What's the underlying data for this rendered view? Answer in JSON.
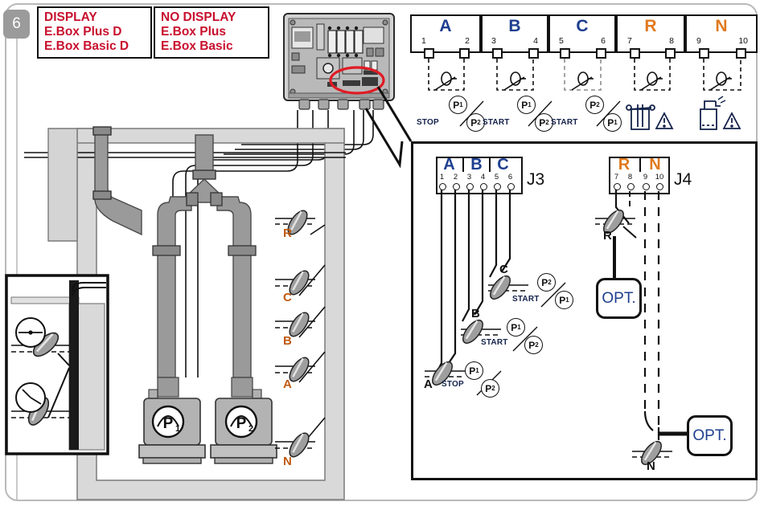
{
  "step": {
    "number": "6"
  },
  "legend": {
    "display": {
      "title": "DISPLAY",
      "line1": "E.Box Plus D",
      "line2": "E.Box Basic D"
    },
    "no_display": {
      "title": "NO DISPLAY",
      "line1": "E.Box Plus",
      "line2": "E.Box Basic"
    },
    "color": "#c8102e"
  },
  "terminal_strip": {
    "groups": [
      {
        "letter": "A",
        "pins": [
          "1",
          "2"
        ],
        "function": "STOP",
        "pumps": [
          "P1",
          "P2"
        ],
        "icon": "float-switch-icon"
      },
      {
        "letter": "B",
        "pins": [
          "3",
          "4"
        ],
        "function": "START",
        "pumps": [
          "P1",
          "P2"
        ],
        "icon": "float-switch-icon"
      },
      {
        "letter": "C",
        "pins": [
          "5",
          "6"
        ],
        "function": "START",
        "pumps": [
          "P2",
          "P1"
        ],
        "icon": "float-switch-icon"
      },
      {
        "letter": "R",
        "pins": [
          "7",
          "8"
        ],
        "function": "",
        "pumps": [],
        "icon": "high-level-alarm-icon"
      },
      {
        "letter": "N",
        "pins": [
          "9",
          "10"
        ],
        "function": "",
        "pumps": [],
        "icon": "dry-run-alarm-icon"
      }
    ]
  },
  "detail": {
    "j3": {
      "label": "J3",
      "groups": [
        {
          "letter": "A",
          "pins": [
            "1",
            "2"
          ]
        },
        {
          "letter": "B",
          "pins": [
            "3",
            "4"
          ]
        },
        {
          "letter": "C",
          "pins": [
            "5",
            "6"
          ]
        }
      ],
      "floats": [
        {
          "name": "C",
          "function": "START",
          "pumps": [
            "P2",
            "P1"
          ]
        },
        {
          "name": "B",
          "function": "START",
          "pumps": [
            "P1",
            "P2"
          ]
        },
        {
          "name": "A",
          "function": "STOP",
          "pumps": [
            "P1",
            "P2"
          ]
        }
      ]
    },
    "j4": {
      "label": "J4",
      "groups": [
        {
          "letter": "R",
          "pins": [
            "7",
            "8"
          ]
        },
        {
          "letter": "N",
          "pins": [
            "9",
            "10"
          ]
        }
      ],
      "floats": [
        {
          "name": "R",
          "option_label": "OPT."
        },
        {
          "name": "N",
          "option_label": "OPT."
        }
      ]
    }
  },
  "tank": {
    "pumps": [
      {
        "name": "P",
        "index": "1"
      },
      {
        "name": "P",
        "index": "2"
      }
    ],
    "floats": [
      "R",
      "C",
      "B",
      "A",
      "N"
    ]
  },
  "colors": {
    "alert_red": "#c8102e",
    "highlight_ellipse": "#e01b24",
    "letter_blue": "#1d3f8f",
    "letter_orange": "#e07a1f",
    "float_label": "#c05a10",
    "label_navy": "#14224a",
    "line": "#111111",
    "pipe_gray": "#9a9a9a",
    "tank_gray": "#d9d9d9"
  }
}
